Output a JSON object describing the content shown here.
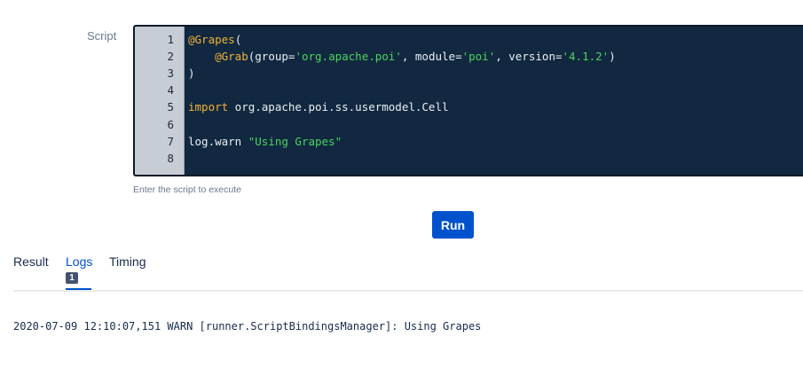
{
  "script_label": "Script",
  "editor": {
    "lines": [
      {
        "num": "1",
        "tokens": [
          {
            "t": "@Grapes",
            "c": "ann"
          },
          {
            "t": "(",
            "c": ""
          }
        ]
      },
      {
        "num": "2",
        "tokens": [
          {
            "t": "    ",
            "c": ""
          },
          {
            "t": "@Grab",
            "c": "ann"
          },
          {
            "t": "(group=",
            "c": ""
          },
          {
            "t": "'org.apache.poi'",
            "c": "str"
          },
          {
            "t": ", module=",
            "c": ""
          },
          {
            "t": "'poi'",
            "c": "str"
          },
          {
            "t": ", version=",
            "c": ""
          },
          {
            "t": "'4.1.2'",
            "c": "str"
          },
          {
            "t": ")",
            "c": ""
          }
        ]
      },
      {
        "num": "3",
        "tokens": [
          {
            "t": ")",
            "c": ""
          }
        ]
      },
      {
        "num": "4",
        "tokens": []
      },
      {
        "num": "5",
        "tokens": [
          {
            "t": "import",
            "c": "kw"
          },
          {
            "t": " org.apache.poi.ss.usermodel.Cell",
            "c": ""
          }
        ]
      },
      {
        "num": "6",
        "tokens": []
      },
      {
        "num": "7",
        "tokens": [
          {
            "t": "log.warn ",
            "c": ""
          },
          {
            "t": "\"Using Grapes\"",
            "c": "str"
          }
        ]
      },
      {
        "num": "8",
        "tokens": []
      }
    ]
  },
  "hint": "Enter the script to execute",
  "run_label": "Run",
  "tabs": [
    {
      "label": "Result",
      "active": false
    },
    {
      "label": "Logs",
      "active": true,
      "badge": "1"
    },
    {
      "label": "Timing",
      "active": false
    }
  ],
  "log_line": "2020-07-09 12:10:07,151 WARN [runner.ScriptBindingsManager]: Using Grapes"
}
